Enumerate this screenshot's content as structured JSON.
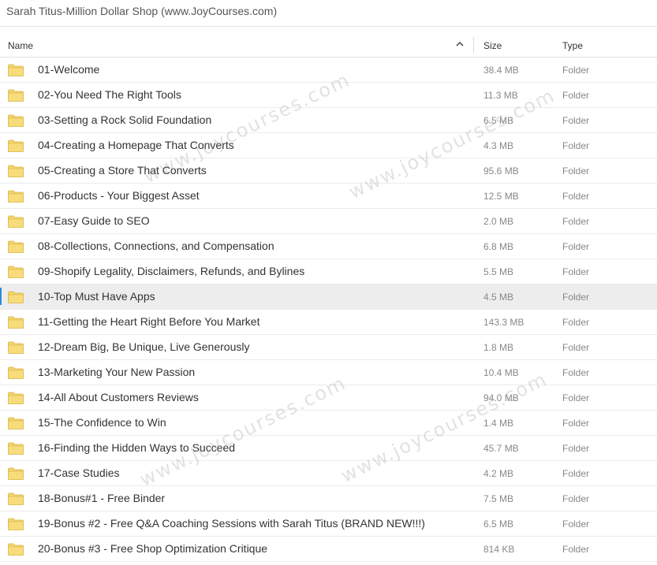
{
  "window": {
    "title": "Sarah Titus-Million Dollar Shop (www.JoyCourses.com)"
  },
  "columns": {
    "name": "Name",
    "size": "Size",
    "type": "Type"
  },
  "icons": {
    "sort": "chevron-up-icon",
    "folder": "folder-icon"
  },
  "colors": {
    "folder": "#f5d36a",
    "folder_edge": "#d8b54a",
    "selection_accent": "#2b8cd8",
    "selected_row_bg": "#ededed"
  },
  "selected_row": 9,
  "rows": [
    {
      "name": "01-Welcome",
      "size": "38.4 MB",
      "type": "Folder"
    },
    {
      "name": "02-You Need The Right Tools",
      "size": "11.3 MB",
      "type": "Folder"
    },
    {
      "name": "03-Setting a Rock Solid Foundation",
      "size": "6.5 MB",
      "type": "Folder"
    },
    {
      "name": "04-Creating a Homepage That Converts",
      "size": "4.3 MB",
      "type": "Folder"
    },
    {
      "name": "05-Creating a Store That Converts",
      "size": "95.6 MB",
      "type": "Folder"
    },
    {
      "name": "06-Products - Your Biggest Asset",
      "size": "12.5 MB",
      "type": "Folder"
    },
    {
      "name": "07-Easy Guide to SEO",
      "size": "2.0 MB",
      "type": "Folder"
    },
    {
      "name": "08-Collections, Connections, and Compensation",
      "size": "6.8 MB",
      "type": "Folder"
    },
    {
      "name": "09-Shopify Legality, Disclaimers, Refunds, and Bylines",
      "size": "5.5 MB",
      "type": "Folder"
    },
    {
      "name": "10-Top Must Have Apps",
      "size": "4.5 MB",
      "type": "Folder"
    },
    {
      "name": "11-Getting the Heart Right Before You Market",
      "size": "143.3 MB",
      "type": "Folder"
    },
    {
      "name": "12-Dream Big, Be Unique, Live Generously",
      "size": "1.8 MB",
      "type": "Folder"
    },
    {
      "name": "13-Marketing Your New Passion",
      "size": "10.4 MB",
      "type": "Folder"
    },
    {
      "name": "14-All About Customers Reviews",
      "size": "94.0 MB",
      "type": "Folder"
    },
    {
      "name": "15-The Confidence to Win",
      "size": "1.4 MB",
      "type": "Folder"
    },
    {
      "name": "16-Finding the Hidden Ways to Succeed",
      "size": "45.7 MB",
      "type": "Folder"
    },
    {
      "name": "17-Case Studies",
      "size": "4.2 MB",
      "type": "Folder"
    },
    {
      "name": "18-Bonus#1 - Free Binder",
      "size": "7.5 MB",
      "type": "Folder"
    },
    {
      "name": "19-Bonus #2 - Free Q&A Coaching Sessions with Sarah Titus (BRAND NEW!!!)",
      "size": "6.5 MB",
      "type": "Folder"
    },
    {
      "name": "20-Bonus #3 - Free Shop Optimization Critique",
      "size": "814 KB",
      "type": "Folder"
    }
  ],
  "watermark": "www.joycourses.com"
}
